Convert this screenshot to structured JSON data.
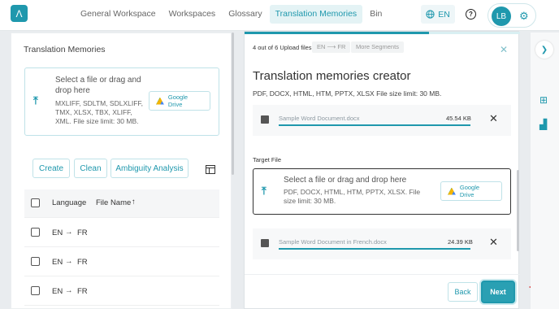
{
  "header": {
    "logo": "Λ",
    "nav": [
      {
        "label": "General Workspace",
        "active": false
      },
      {
        "label": "Workspaces",
        "active": false
      },
      {
        "label": "Glossary",
        "active": false
      },
      {
        "label": "Translation Memories",
        "active": true
      },
      {
        "label": "Bin",
        "active": false
      }
    ],
    "language": "EN",
    "help_glyph": "?",
    "user_initials": "LB"
  },
  "left_panel": {
    "title": "Translation Memories",
    "upload": {
      "title": "Select a file or drag and drop here",
      "types": "MXLIFF, SDLTM, SDLXLIFF, TMX, XLSX, TBX, XLIFF, XML. File size limit: 30 MB.",
      "gdrive_label": "Google Drive"
    },
    "buttons": {
      "create": "Create",
      "clean": "Clean",
      "ambiguity": "Ambiguity Analysis"
    },
    "table": {
      "headers": {
        "language": "Language",
        "file_name": "File Name"
      },
      "rows": [
        {
          "from": "EN",
          "to": "FR"
        },
        {
          "from": "EN",
          "to": "FR"
        },
        {
          "from": "EN",
          "to": "FR"
        }
      ]
    }
  },
  "modal": {
    "step_text": "4 out of 6 Upload files",
    "chips": {
      "lang_from": "EN",
      "lang_to": "FR",
      "more_segments": "More Segments"
    },
    "title": "Translation memories creator",
    "subtitle": "PDF, DOCX, HTML, HTM, PPTX, XLSX File size limit: 30 MB.",
    "source_file": {
      "name": "Sample Word Document.docx",
      "size": "45.54 KB"
    },
    "target_label": "Target File",
    "target_upload": {
      "title": "Select a file or drag and drop here",
      "types": "PDF, DOCX, HTML, HTM, PPTX, XLSX. File size limit: 30 MB.",
      "gdrive_label": "Google Drive"
    },
    "target_file": {
      "name": "Sample Word Document in French.docx",
      "size": "24.39 KB"
    },
    "back_label": "Back",
    "next_label": "Next",
    "progress_fraction": 0.67
  },
  "colors": {
    "accent": "#1f98ad",
    "annotation_arrow": "#d62b2b"
  }
}
